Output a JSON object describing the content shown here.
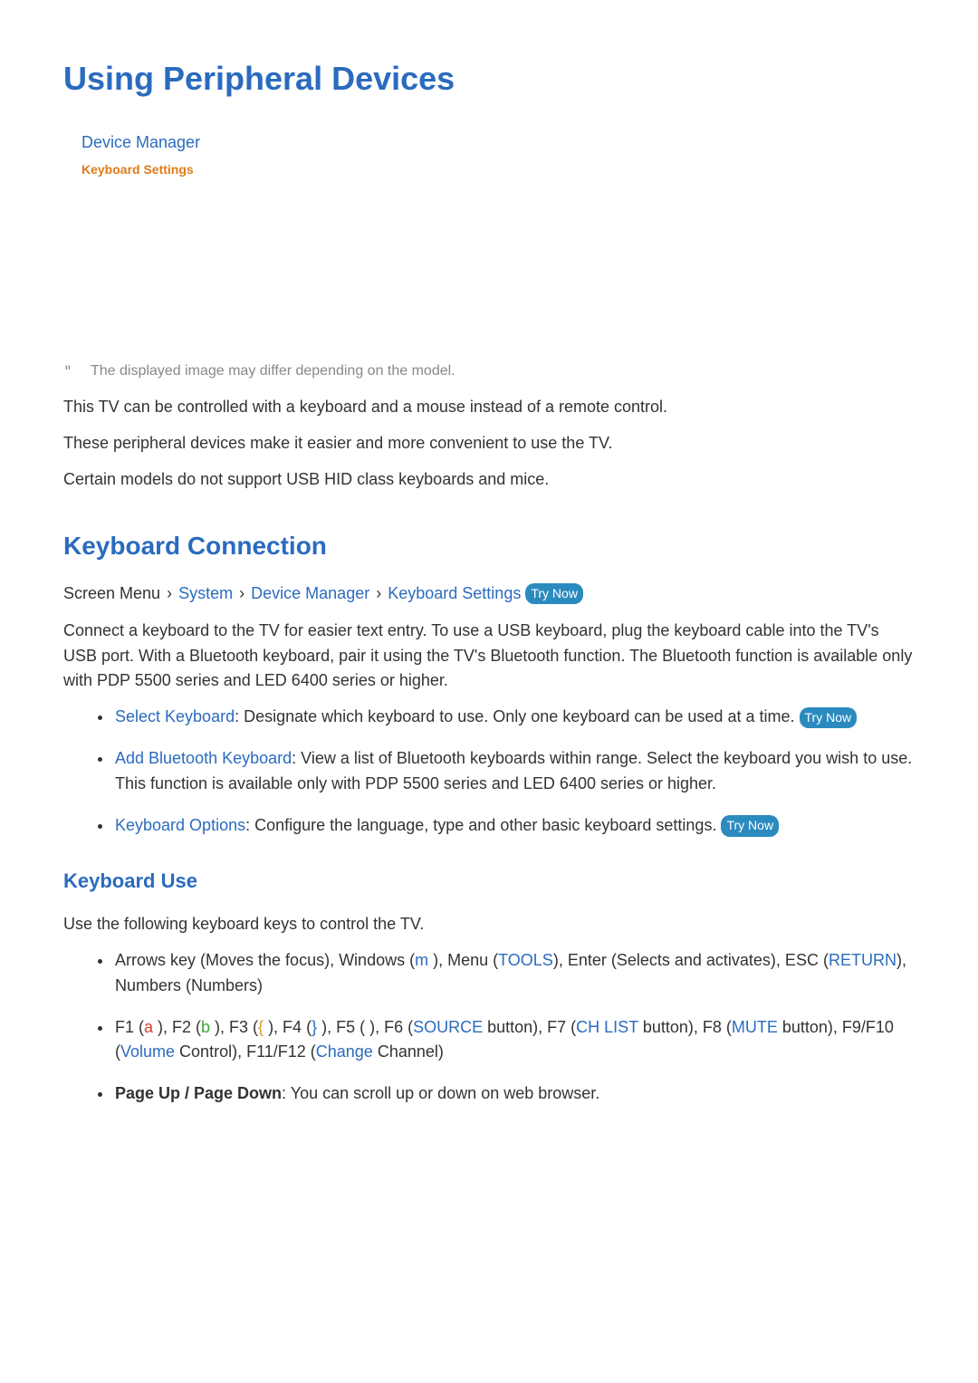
{
  "title": "Using Peripheral Devices",
  "menu_snippet": {
    "device_manager": "Device Manager",
    "keyboard_settings": "Keyboard Settings"
  },
  "note": {
    "mark": "\"",
    "text": "The displayed image may differ depending on the model."
  },
  "intro": [
    "This TV can be controlled with a keyboard and a mouse instead of a remote control.",
    "These peripheral devices make it easier and more convenient to use the TV.",
    "Certain models do not support USB HID class keyboards and mice."
  ],
  "section_kc": {
    "title": "Keyboard Connection",
    "breadcrumb": {
      "prefix": "Screen Menu",
      "items": [
        "System",
        "Device Manager",
        "Keyboard Settings"
      ],
      "try_now": "Try Now"
    },
    "desc": "Connect a keyboard to the TV for easier text entry. To use a USB keyboard, plug the keyboard cable into the TV's USB port. With a Bluetooth keyboard, pair it using the TV's Bluetooth function. The Bluetooth function is available only with PDP 5500 series and LED 6400 series or higher.",
    "options": [
      {
        "name": "Select Keyboard",
        "sep": ": ",
        "text": "Designate which keyboard to use. Only one keyboard can be used at a time.",
        "try_now": "Try Now"
      },
      {
        "name": "Add Bluetooth Keyboard",
        "sep": ": ",
        "text": "View a list of Bluetooth keyboards within range. Select the keyboard you wish to use. This function is available only with PDP 5500 series and LED 6400 series or higher.",
        "try_now": ""
      },
      {
        "name": "Keyboard Options",
        "sep": ": ",
        "text": "Configure the language, type and other basic keyboard settings.",
        "try_now": "Try Now"
      }
    ]
  },
  "section_ku": {
    "title": "Keyboard Use",
    "intro": "Use the following keyboard keys to control the TV.",
    "items": {
      "row1": {
        "t1": "Arrows key (Moves the focus), Windows (",
        "m": "m",
        "t2": " ), Menu (",
        "tools": "TOOLS",
        "t3": "), Enter (Selects and activates), ESC (",
        "return": "RETURN",
        "t4": "), Numbers (Numbers)"
      },
      "row2": {
        "t1": "F1 (",
        "a": "a",
        "t2": " ), F2 (",
        "b": "b",
        "t3": " ), F3 (",
        "lb": "{",
        "t4": " ), F4 (",
        "rb": "}",
        "t5": " ), F5 (    ), F6 (",
        "source": "SOURCE",
        "t6": " button), F7 (",
        "chlist": "CH LIST",
        "t7": " button), F8 (",
        "mute": "MUTE",
        "t8": " button), F9/F10 (",
        "volume": "Volume",
        "t9": " Control), F11/F12 (",
        "change": "Change",
        "t10": " Channel)"
      },
      "row3": {
        "name": "Page Up / Page Down",
        "sep": ": ",
        "text": "You can scroll up or down on web browser."
      }
    }
  }
}
